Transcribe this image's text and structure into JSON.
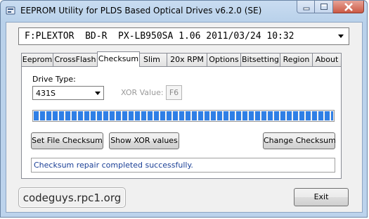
{
  "window": {
    "title": "EEPROM Utility for PLDS Based Optical Drives v6.2.0 (SE)"
  },
  "drive_select": {
    "value": "F:PLEXTOR  BD-R  PX-LB950SA 1.06 2011/03/24 10:32"
  },
  "tabs": [
    {
      "label": "Eeprom"
    },
    {
      "label": "CrossFlash"
    },
    {
      "label": "Checksum"
    },
    {
      "label": "Slim"
    },
    {
      "label": "20x RPM"
    },
    {
      "label": "Options"
    },
    {
      "label": "Bitsetting"
    },
    {
      "label": "Region"
    },
    {
      "label": "About"
    }
  ],
  "active_tab": "Checksum",
  "checksum": {
    "drive_type_label": "Drive Type:",
    "drive_type_value": "431S",
    "xor_label": "XOR Value:",
    "xor_value": "F6",
    "progress_percent": 100,
    "set_file_checksum_label": "Set File Checksum",
    "show_xor_label": "Show XOR values",
    "change_checksum_label": "Change Checksum",
    "status_text": "Checksum repair completed successfully."
  },
  "footer": {
    "link_text": "codeguys.rpc1.org",
    "exit_label": "Exit"
  },
  "colors": {
    "progress_fill": "#2f7fe6",
    "status_text": "#1a3f96",
    "window_frame": "#bcd3ec"
  }
}
